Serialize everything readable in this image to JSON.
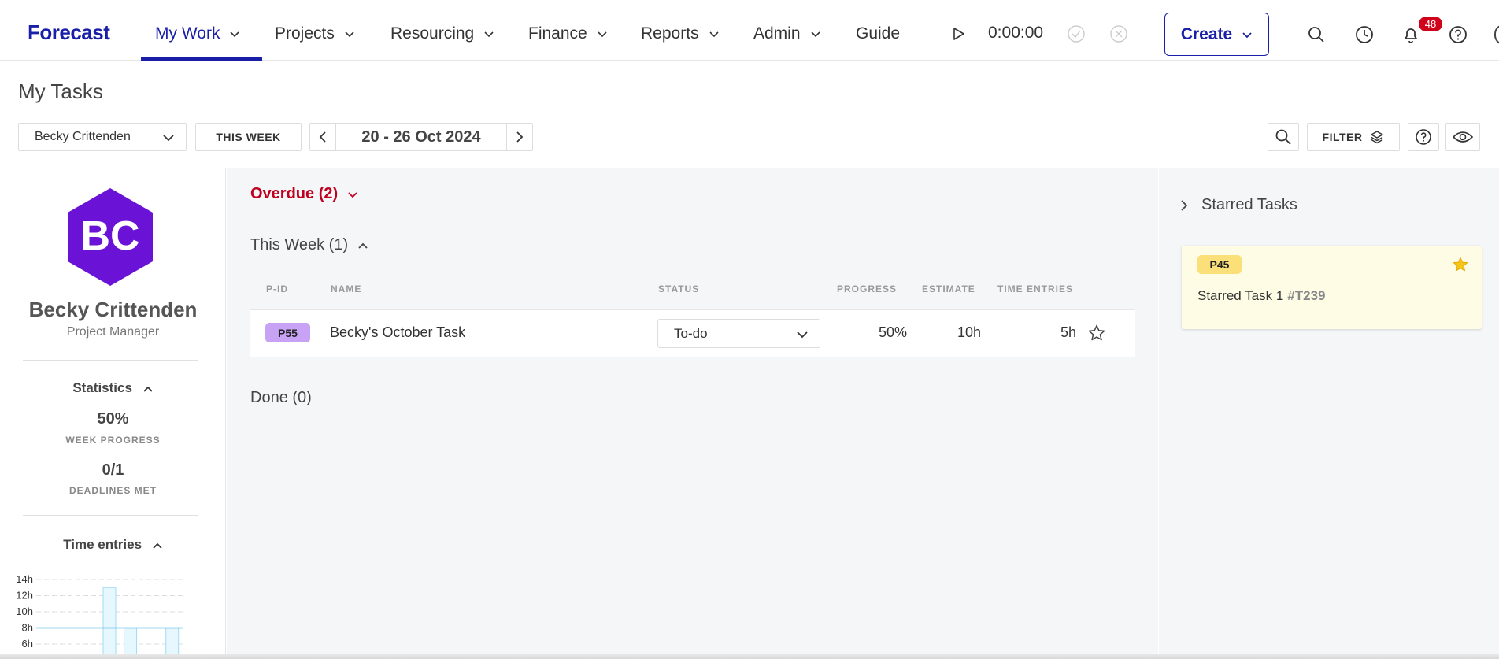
{
  "nav": {
    "logo": "Forecast",
    "items": [
      {
        "label": "My Work"
      },
      {
        "label": "Projects"
      },
      {
        "label": "Resourcing"
      },
      {
        "label": "Finance"
      },
      {
        "label": "Reports"
      },
      {
        "label": "Admin"
      },
      {
        "label": "Guide"
      }
    ],
    "timer": "0:00:00",
    "create_label": "Create",
    "notifications_count": "48"
  },
  "header": {
    "title": "My Tasks",
    "selected_person": "Becky Crittenden",
    "week_button": "THIS WEEK",
    "date_range": "20 - 26 Oct 2024",
    "filter_label": "FILTER"
  },
  "profile": {
    "initials": "BC",
    "name": "Becky Crittenden",
    "role": "Project Manager",
    "avatar_color": "#6a12d6"
  },
  "statistics": {
    "heading": "Statistics",
    "week_progress_value": "50%",
    "week_progress_label": "WEEK PROGRESS",
    "deadlines_value": "0/1",
    "deadlines_label": "DEADLINES MET"
  },
  "time_entries": {
    "heading": "Time entries",
    "chart_data": {
      "type": "bar",
      "ytick_labels": [
        "14h",
        "12h",
        "10h",
        "8h",
        "6h"
      ],
      "ylim": [
        4,
        14
      ],
      "target_line": 8,
      "values": [
        null,
        null,
        null,
        13,
        8,
        null,
        8
      ],
      "bar_color": "#e6f7fe",
      "bar_border": "#9fdcf5",
      "line_color": "#4db6e0"
    }
  },
  "groups": {
    "overdue": "Overdue (2)",
    "this_week": "This Week (1)",
    "done": "Done (0)"
  },
  "table": {
    "columns": {
      "pid": "P-ID",
      "name": "NAME",
      "status": "STATUS",
      "progress": "PROGRESS",
      "estimate": "ESTIMATE",
      "time_entries": "TIME ENTRIES"
    },
    "rows": [
      {
        "pid": "P55",
        "name": "Becky's October Task",
        "status": "To-do",
        "progress": "50%",
        "estimate": "10h",
        "time_entries": "5h"
      }
    ]
  },
  "starred": {
    "heading": "Starred Tasks",
    "cards": [
      {
        "pid": "P45",
        "title": "Starred Task 1",
        "task_id": "#T239"
      }
    ]
  },
  "colors": {
    "brand": "#1a1fa8",
    "overdue": "#c0001f",
    "pid_pill": "#c7a2f5",
    "starred_pill": "#fbe07a",
    "star_fill": "#f5c518"
  }
}
